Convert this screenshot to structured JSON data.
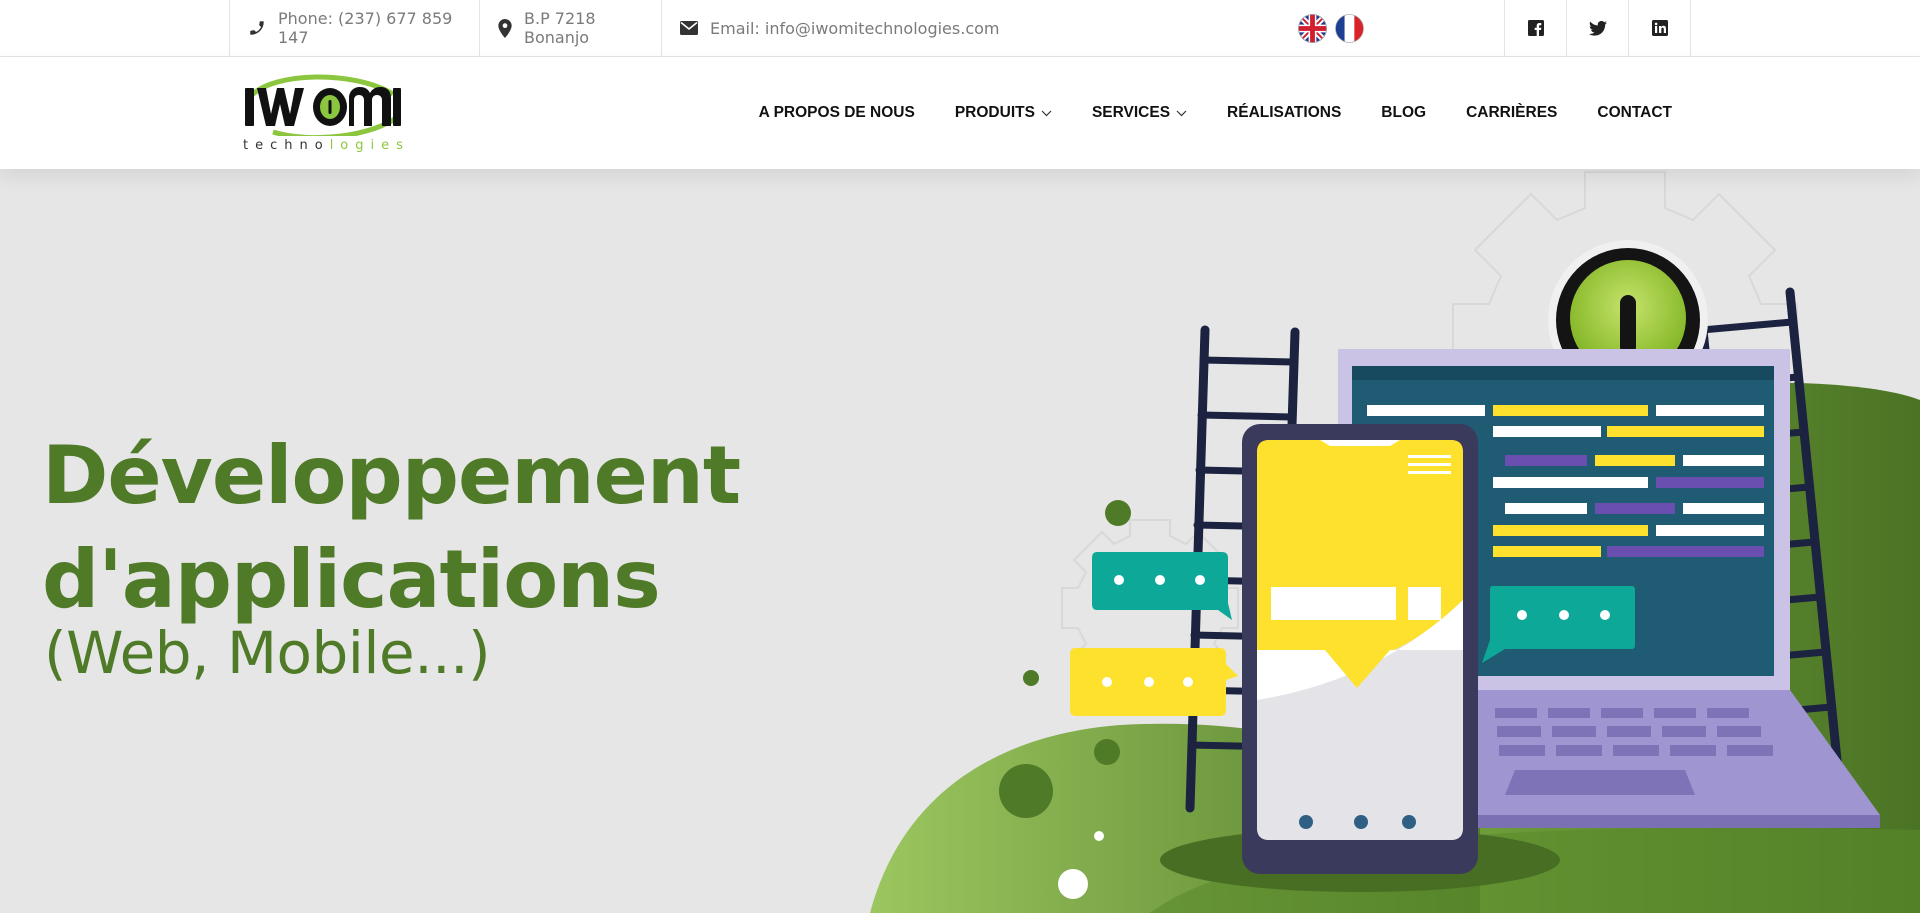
{
  "topbar": {
    "phone": "Phone: (237) 677 859 147",
    "address": "B.P 7218 Bonanjo",
    "email": "Email: info@iwomitechnologies.com",
    "languages": [
      "english-flag-icon",
      "french-flag-icon"
    ],
    "social": [
      "facebook-icon",
      "twitter-icon",
      "linkedin-icon"
    ]
  },
  "logo": {
    "mark": "iwomi",
    "tagline_dark": "techno",
    "tagline_green": "logies"
  },
  "nav": {
    "items": [
      {
        "label": "A PROPOS DE NOUS",
        "dropdown": false
      },
      {
        "label": "PRODUITS",
        "dropdown": true
      },
      {
        "label": "SERVICES",
        "dropdown": true
      },
      {
        "label": "RÉALISATIONS",
        "dropdown": false
      },
      {
        "label": "BLOG",
        "dropdown": false
      },
      {
        "label": "CARRIÈRES",
        "dropdown": false
      },
      {
        "label": "CONTACT",
        "dropdown": false
      }
    ]
  },
  "hero": {
    "title_line1": "Développement",
    "title_line2": "d'applications",
    "subtitle": "(Web, Mobile...)"
  },
  "colors": {
    "brand_green": "#4f7a28",
    "light_green": "#8cc63f",
    "yellow": "#fde12d",
    "teal": "#0ea899",
    "navy": "#3a3a5c"
  }
}
